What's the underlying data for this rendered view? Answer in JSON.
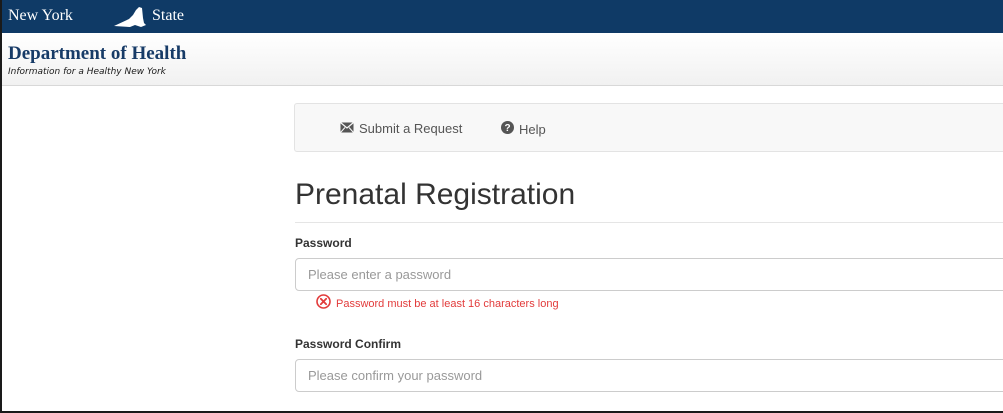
{
  "banner": {
    "left_text": "New York",
    "right_text": "State"
  },
  "header": {
    "title": "Department of Health",
    "tagline": "Information for a Healthy New York"
  },
  "nav": {
    "submit_label": "Submit a Request",
    "help_label": "Help"
  },
  "page": {
    "title": "Prenatal Registration"
  },
  "form": {
    "password": {
      "label": "Password",
      "placeholder": "Please enter a password",
      "value": "",
      "error": "Password must be at least 16 characters long"
    },
    "password_confirm": {
      "label": "Password Confirm",
      "placeholder": "Please confirm your password",
      "value": ""
    }
  },
  "colors": {
    "banner": "#0f3a66",
    "header_title": "#173b67",
    "error": "#e23b3b"
  },
  "icons": {
    "state_logo": "new-york-state-shape-icon",
    "submit": "envelope-icon",
    "help": "question-circle-icon",
    "error": "error-x-circle-icon"
  }
}
